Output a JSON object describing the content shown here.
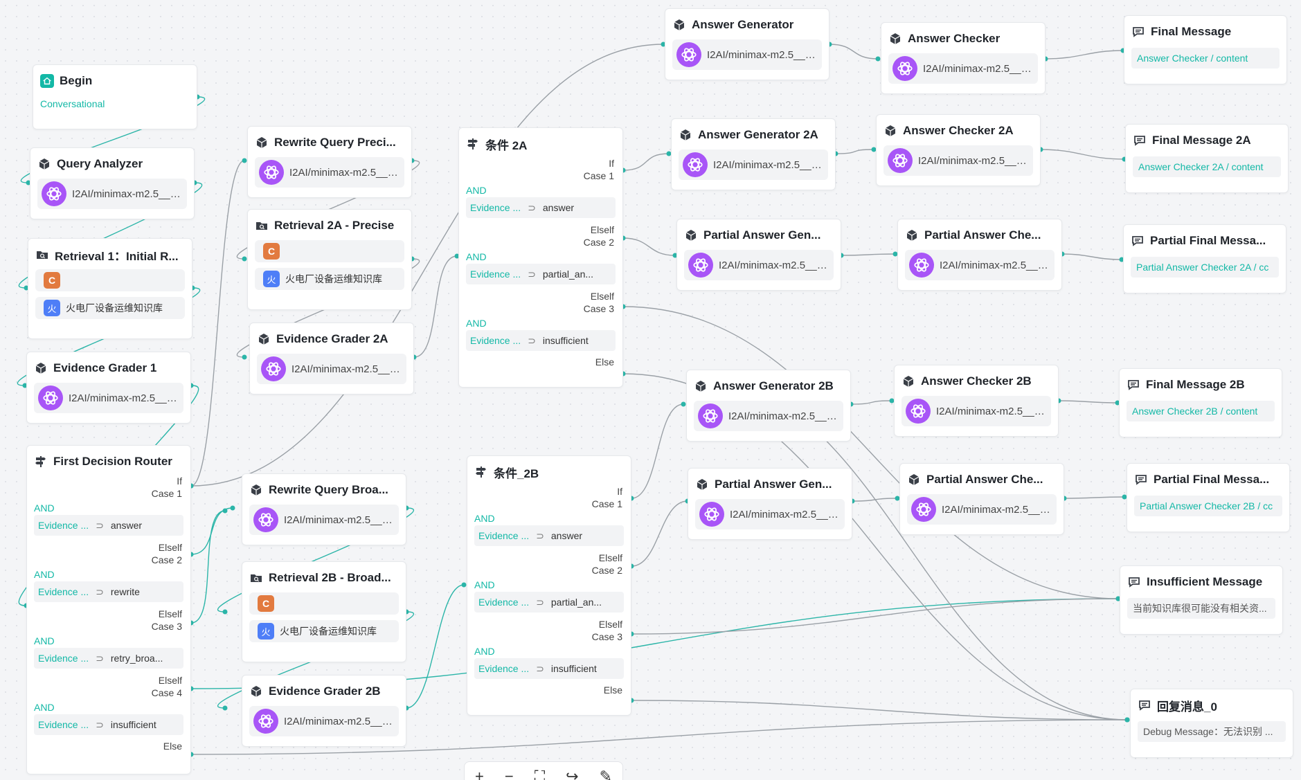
{
  "canvas": {
    "edge_color": "#9aa0a6",
    "edge_highlight": "#2bb5a8",
    "accent": "#13b8a6",
    "toolbar_icons": [
      "plus-icon",
      "minus-icon",
      "fit-view-icon",
      "redo-icon",
      "pen-icon"
    ]
  },
  "nodes": {
    "begin": {
      "title": "Begin",
      "subtitle": "Conversational"
    },
    "query_analyzer": {
      "title": "Query Analyzer",
      "model": "I2AI/minimax-m2.5___..."
    },
    "retrieval_1": {
      "title": "Retrieval 1：Initial R...",
      "kb_c": "",
      "kb_name": "火电厂设备运维知识库"
    },
    "evidence_grader_1": {
      "title": "Evidence Grader 1",
      "model": "I2AI/minimax-m2.5___..."
    },
    "first_router": {
      "title": "First Decision Router",
      "cases": [
        {
          "if": "If",
          "case": "Case 1",
          "and": "AND",
          "evidence": "Evidence ...",
          "value": "answer"
        },
        {
          "if": "Elself",
          "case": "Case 2",
          "and": "AND",
          "evidence": "Evidence ...",
          "value": "rewrite"
        },
        {
          "if": "Elself",
          "case": "Case 3",
          "and": "AND",
          "evidence": "Evidence ...",
          "value": "retry_broa..."
        },
        {
          "if": "Elself",
          "case": "Case 4",
          "and": "AND",
          "evidence": "Evidence ...",
          "value": "insufficient"
        }
      ],
      "else": "Else"
    },
    "rewrite_precise": {
      "title": "Rewrite Query Preci...",
      "model": "I2AI/minimax-m2.5___..."
    },
    "retrieval_2a": {
      "title": "Retrieval 2A - Precise",
      "kb_name": "火电厂设备运维知识库"
    },
    "evidence_grader_2a": {
      "title": "Evidence Grader 2A",
      "model": "I2AI/minimax-m2.5___..."
    },
    "rewrite_broad": {
      "title": "Rewrite Query Broa...",
      "model": "I2AI/minimax-m2.5___..."
    },
    "retrieval_2b": {
      "title": "Retrieval 2B - Broad...",
      "kb_name": "火电厂设备运维知识库"
    },
    "evidence_grader_2b": {
      "title": "Evidence Grader 2B",
      "model": "I2AI/minimax-m2.5___..."
    },
    "cond_2a": {
      "title": "条件 2A",
      "cases": [
        {
          "if": "If",
          "case": "Case 1",
          "and": "AND",
          "evidence": "Evidence ...",
          "value": "answer"
        },
        {
          "if": "Elself",
          "case": "Case 2",
          "and": "AND",
          "evidence": "Evidence ...",
          "value": "partial_an..."
        },
        {
          "if": "Elself",
          "case": "Case 3",
          "and": "AND",
          "evidence": "Evidence ...",
          "value": "insufficient"
        }
      ],
      "else": "Else"
    },
    "cond_2b": {
      "title": "条件_2B",
      "cases": [
        {
          "if": "If",
          "case": "Case 1",
          "and": "AND",
          "evidence": "Evidence ...",
          "value": "answer"
        },
        {
          "if": "Elself",
          "case": "Case 2",
          "and": "AND",
          "evidence": "Evidence ...",
          "value": "partial_an..."
        },
        {
          "if": "Elself",
          "case": "Case 3",
          "and": "AND",
          "evidence": "Evidence ...",
          "value": "insufficient"
        }
      ],
      "else": "Else"
    },
    "answer_generator": {
      "title": "Answer Generator",
      "model": "I2AI/minimax-m2.5___..."
    },
    "answer_generator_2a": {
      "title": "Answer Generator 2A",
      "model": "I2AI/minimax-m2.5___..."
    },
    "partial_answer_gen_a": {
      "title": "Partial Answer Gen...",
      "model": "I2AI/minimax-m2.5___..."
    },
    "answer_generator_2b": {
      "title": "Answer Generator 2B",
      "model": "I2AI/minimax-m2.5___..."
    },
    "partial_answer_gen_b": {
      "title": "Partial Answer Gen...",
      "model": "I2AI/minimax-m2.5___..."
    },
    "answer_checker": {
      "title": "Answer Checker",
      "model": "I2AI/minimax-m2.5___..."
    },
    "answer_checker_2a": {
      "title": "Answer Checker 2A",
      "model": "I2AI/minimax-m2.5___..."
    },
    "partial_answer_che_a": {
      "title": "Partial Answer Che...",
      "model": "I2AI/minimax-m2.5___..."
    },
    "answer_checker_2b": {
      "title": "Answer Checker 2B",
      "model": "I2AI/minimax-m2.5___..."
    },
    "partial_answer_che_b": {
      "title": "Partial Answer Che...",
      "model": "I2AI/minimax-m2.5___..."
    },
    "final_message": {
      "title": "Final Message",
      "content": "Answer Checker / content"
    },
    "final_message_2a": {
      "title": "Final Message 2A",
      "content": "Answer Checker 2A / content"
    },
    "partial_final_a": {
      "title": "Partial Final Messa...",
      "content": "Partial Answer Checker 2A / cc"
    },
    "final_message_2b": {
      "title": "Final Message 2B",
      "content": "Answer Checker 2B / content"
    },
    "partial_final_b": {
      "title": "Partial Final Messa...",
      "content": "Partial Answer Checker 2B / cc"
    },
    "insufficient_message": {
      "title": "Insufficient Message",
      "content": "当前知识库很可能没有相关资..."
    },
    "reply_0": {
      "title": "回复消息_0",
      "content": "Debug Message：无法识别 ..."
    }
  }
}
